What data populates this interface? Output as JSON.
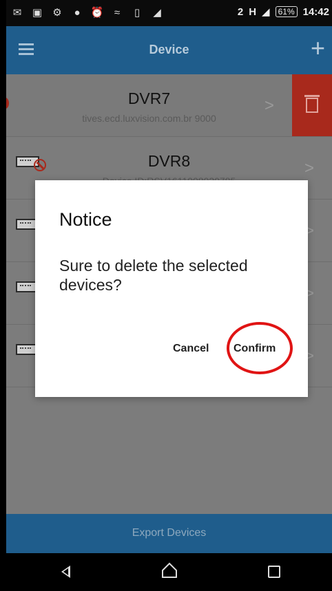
{
  "status_bar": {
    "battery": "61%",
    "time": "14:42",
    "network": "H",
    "sim": "2"
  },
  "app_bar": {
    "title": "Device",
    "menu_icon": "hamburger-menu-icon",
    "add_icon": "plus-icon"
  },
  "devices": [
    {
      "name": "DVR7",
      "subtitle": "tives.ecd.luxvision.com.br   9000"
    },
    {
      "name": "DVR8",
      "subtitle": "Device ID:RSV1611008020785"
    },
    {
      "name": "",
      "subtitle": ""
    },
    {
      "name": "",
      "subtitle": ""
    },
    {
      "name": "",
      "subtitle": ""
    }
  ],
  "dialog": {
    "title": "Notice",
    "message": "Sure to delete the selected devices?",
    "cancel_label": "Cancel",
    "confirm_label": "Confirm"
  },
  "bottom": {
    "export_label": "Export Devices"
  },
  "colors": {
    "primary": "#1f5d8c",
    "delete_red": "#a8291c",
    "highlight_circle": "#e01414"
  }
}
